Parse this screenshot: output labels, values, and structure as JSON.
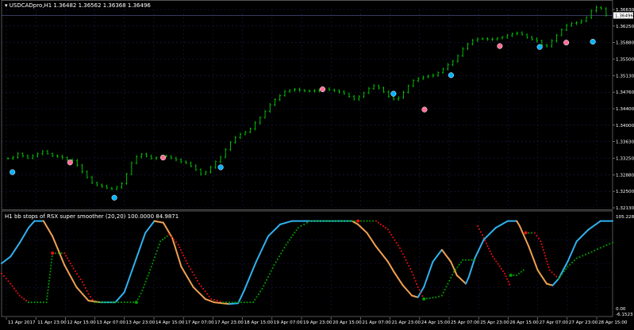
{
  "main": {
    "symbol_label": "USDCADpro,H1",
    "ohlc_label": "1.36482 1.36562 1.36368 1.36496",
    "current_price": "1.36496",
    "price_ticks": [
      "1.36630",
      "1.36250",
      "1.35880",
      "1.35500",
      "1.35130",
      "1.34760",
      "1.34400",
      "1.34000",
      "1.33630",
      "1.33250",
      "1.32880",
      "1.32500",
      "1.32130"
    ],
    "colors": {
      "bull": "#00d000",
      "marker_pink": "#ff6e96",
      "marker_cyan": "#00b4ff",
      "grid": "#1c1c50"
    }
  },
  "indicator": {
    "title": "H1 bb stops of RSX super smoother (20,20) 100.0000 84.9871",
    "axis_ticks": [
      "105.228",
      "0.00",
      "-6.1523"
    ],
    "colors": {
      "rsx_up": "#2fb2ee",
      "rsx_down": "#f0a050",
      "stop_up": "#00a000",
      "stop_down": "#ee1010"
    }
  },
  "time_ticks": [
    "11 Apr 2017",
    "11 Apr 23:00",
    "12 Apr 15:00",
    "13 Apr 07:00",
    "13 Apr 23:00",
    "14 Apr 15:00",
    "17 Apr 07:00",
    "17 Apr 23:00",
    "18 Apr 15:00",
    "19 Apr 07:00",
    "19 Apr 23:00",
    "20 Apr 15:00",
    "21 Apr 07:00",
    "21 Apr 23:00",
    "24 Apr 15:00",
    "25 Apr 07:00",
    "25 Apr 23:00",
    "26 Apr 15:00",
    "27 Apr 07:00",
    "27 Apr 23:00",
    "28 Apr 15:00"
  ],
  "chart_data": {
    "type": "line",
    "close": [
      1.3325,
      1.3328,
      1.3336,
      1.3331,
      1.3326,
      1.3331,
      1.3336,
      1.3341,
      1.3336,
      1.3331,
      1.333,
      1.3327,
      1.3322,
      1.332,
      1.331,
      1.3295,
      1.3282,
      1.327,
      1.3265,
      1.3262,
      1.3258,
      1.3256,
      1.326,
      1.3268,
      1.329,
      1.3315,
      1.3329,
      1.3335,
      1.333,
      1.3325,
      1.3327,
      1.333,
      1.333,
      1.3326,
      1.3322,
      1.3318,
      1.3315,
      1.3308,
      1.33,
      1.329,
      1.3294,
      1.3305,
      1.3318,
      1.3328,
      1.3345,
      1.3362,
      1.3373,
      1.338,
      1.3385,
      1.3392,
      1.3406,
      1.3418,
      1.3432,
      1.3447,
      1.3459,
      1.3468,
      1.3477,
      1.348,
      1.3482,
      1.348,
      1.3478,
      1.3478,
      1.3479,
      1.3481,
      1.3483,
      1.3481,
      1.3479,
      1.3476,
      1.3472,
      1.3466,
      1.346,
      1.3465,
      1.3474,
      1.3484,
      1.349,
      1.3485,
      1.3476,
      1.3466,
      1.346,
      1.3463,
      1.3475,
      1.349,
      1.3502,
      1.3506,
      1.351,
      1.3512,
      1.3514,
      1.352,
      1.3528,
      1.3538,
      1.3546,
      1.3558,
      1.3574,
      1.3585,
      1.3593,
      1.3596,
      1.3597,
      1.3595,
      1.3596,
      1.3598,
      1.36,
      1.3604,
      1.3608,
      1.361,
      1.3606,
      1.36,
      1.3596,
      1.3592,
      1.3582,
      1.358,
      1.3592,
      1.3605,
      1.3617,
      1.3627,
      1.3632,
      1.3633,
      1.3637,
      1.3645,
      1.366,
      1.3668,
      1.3665,
      1.365
    ],
    "markers": [
      {
        "bar": 1,
        "price": 1.3294,
        "color": "cyan"
      },
      {
        "bar": 14,
        "price": 1.3316,
        "color": "pink"
      },
      {
        "bar": 24,
        "price": 1.3236,
        "color": "cyan"
      },
      {
        "bar": 35,
        "price": 1.3327,
        "color": "pink"
      },
      {
        "bar": 48,
        "price": 1.3305,
        "color": "cyan"
      },
      {
        "bar": 71,
        "price": 1.3482,
        "color": "pink"
      },
      {
        "bar": 87,
        "price": 1.3472,
        "color": "cyan"
      },
      {
        "bar": 94,
        "price": 1.3436,
        "color": "pink"
      },
      {
        "bar": 100,
        "price": 1.3514,
        "color": "cyan"
      },
      {
        "bar": 111,
        "price": 1.358,
        "color": "pink"
      },
      {
        "bar": 120,
        "price": 1.3578,
        "color": "cyan"
      },
      {
        "bar": 126,
        "price": 1.3588,
        "color": "pink"
      },
      {
        "bar": 132,
        "price": 1.359,
        "color": "cyan"
      }
    ],
    "rsx": [
      [
        -6.1,
        50
      ],
      [
        -5.8,
        58
      ],
      [
        -5.5,
        74
      ],
      [
        -5.2,
        92
      ],
      [
        -5.0,
        100
      ],
      [
        -4.7,
        100
      ],
      [
        -4.4,
        82
      ],
      [
        -4.0,
        48
      ],
      [
        -3.6,
        22
      ],
      [
        -3.2,
        6
      ],
      [
        -2.8,
        4
      ],
      [
        -2.5,
        4
      ],
      [
        -2.3,
        4
      ],
      [
        -2.0,
        16
      ],
      [
        -1.6,
        56
      ],
      [
        -1.3,
        86
      ],
      [
        -1.0,
        100
      ],
      [
        -0.7,
        98
      ],
      [
        -0.4,
        80
      ],
      [
        -0.1,
        46
      ],
      [
        0.3,
        22
      ],
      [
        0.7,
        8
      ],
      [
        1.0,
        4
      ],
      [
        1.5,
        2
      ],
      [
        1.8,
        3
      ],
      [
        2.0,
        18
      ],
      [
        2.4,
        52
      ],
      [
        2.8,
        82
      ],
      [
        3.2,
        96
      ],
      [
        3.6,
        100
      ],
      [
        4.0,
        100
      ],
      [
        4.4,
        100
      ],
      [
        4.8,
        100
      ],
      [
        5.2,
        100
      ],
      [
        5.6,
        100
      ],
      [
        5.8,
        96
      ],
      [
        6.1,
        86
      ],
      [
        6.4,
        70
      ],
      [
        6.8,
        52
      ],
      [
        7.0,
        40
      ],
      [
        7.3,
        24
      ],
      [
        7.6,
        12
      ],
      [
        7.8,
        10
      ],
      [
        8.0,
        22
      ],
      [
        8.3,
        52
      ],
      [
        8.6,
        66
      ],
      [
        8.9,
        52
      ],
      [
        9.1,
        36
      ],
      [
        9.4,
        26
      ],
      [
        9.5,
        34
      ],
      [
        9.7,
        56
      ],
      [
        10.0,
        78
      ],
      [
        10.4,
        92
      ],
      [
        10.8,
        100
      ],
      [
        11.1,
        100
      ],
      [
        11.2,
        94
      ],
      [
        11.5,
        70
      ],
      [
        11.8,
        42
      ],
      [
        12.1,
        26
      ],
      [
        12.3,
        24
      ],
      [
        12.5,
        32
      ],
      [
        12.8,
        52
      ],
      [
        13.1,
        76
      ],
      [
        13.5,
        90
      ],
      [
        13.9,
        100
      ],
      [
        14.3,
        100
      ]
    ],
    "stops": [
      [
        -6.1,
        38
      ],
      [
        -5.8,
        26
      ],
      [
        -5.5,
        12
      ],
      [
        -5.2,
        4
      ],
      [
        -4.8,
        4
      ],
      [
        -4.6,
        4
      ],
      [
        -4.4,
        62
      ],
      [
        -4.0,
        62
      ],
      [
        -3.7,
        44
      ],
      [
        -3.4,
        28
      ],
      [
        -3.2,
        14
      ],
      [
        -3.0,
        4
      ],
      [
        -2.6,
        4
      ],
      [
        -2.2,
        4
      ],
      [
        -1.8,
        4
      ],
      [
        -1.6,
        4
      ],
      [
        -1.4,
        18
      ],
      [
        -1.1,
        46
      ],
      [
        -0.8,
        76
      ],
      [
        -0.5,
        84
      ],
      [
        -0.2,
        72
      ],
      [
        0.1,
        50
      ],
      [
        0.5,
        26
      ],
      [
        0.9,
        8
      ],
      [
        1.3,
        4
      ],
      [
        1.8,
        4
      ],
      [
        2.3,
        4
      ],
      [
        2.6,
        20
      ],
      [
        3.0,
        48
      ],
      [
        3.4,
        72
      ],
      [
        3.8,
        92
      ],
      [
        4.2,
        100
      ],
      [
        4.6,
        100
      ],
      [
        5.2,
        100
      ],
      [
        5.8,
        100
      ],
      [
        5.8,
        100
      ],
      [
        6.4,
        100
      ],
      [
        6.8,
        90
      ],
      [
        7.2,
        68
      ],
      [
        7.6,
        40
      ],
      [
        7.8,
        22
      ],
      [
        8.0,
        8
      ],
      [
        8.0,
        8
      ],
      [
        8.4,
        10
      ],
      [
        8.6,
        12
      ],
      [
        9.0,
        40
      ],
      [
        9.3,
        54
      ],
      [
        9.6,
        54
      ],
      [
        9.8,
        54
      ],
      [
        9.8,
        94
      ],
      [
        10.0,
        80
      ],
      [
        10.3,
        58
      ],
      [
        10.7,
        38
      ],
      [
        10.9,
        22
      ],
      [
        10.9,
        36
      ],
      [
        11.1,
        36
      ],
      [
        11.4,
        44
      ],
      [
        11.4,
        86
      ],
      [
        11.7,
        86
      ],
      [
        11.9,
        76
      ],
      [
        12.2,
        42
      ],
      [
        12.5,
        32
      ],
      [
        12.8,
        46
      ],
      [
        13.1,
        56
      ],
      [
        13.5,
        62
      ],
      [
        14.0,
        70
      ],
      [
        14.4,
        76
      ]
    ],
    "x_range": [
      -6.1,
      14.3
    ],
    "ylim_indicator": [
      -6.1523,
      105.228
    ],
    "ylim_main": [
      1.3213,
      1.3663
    ]
  }
}
